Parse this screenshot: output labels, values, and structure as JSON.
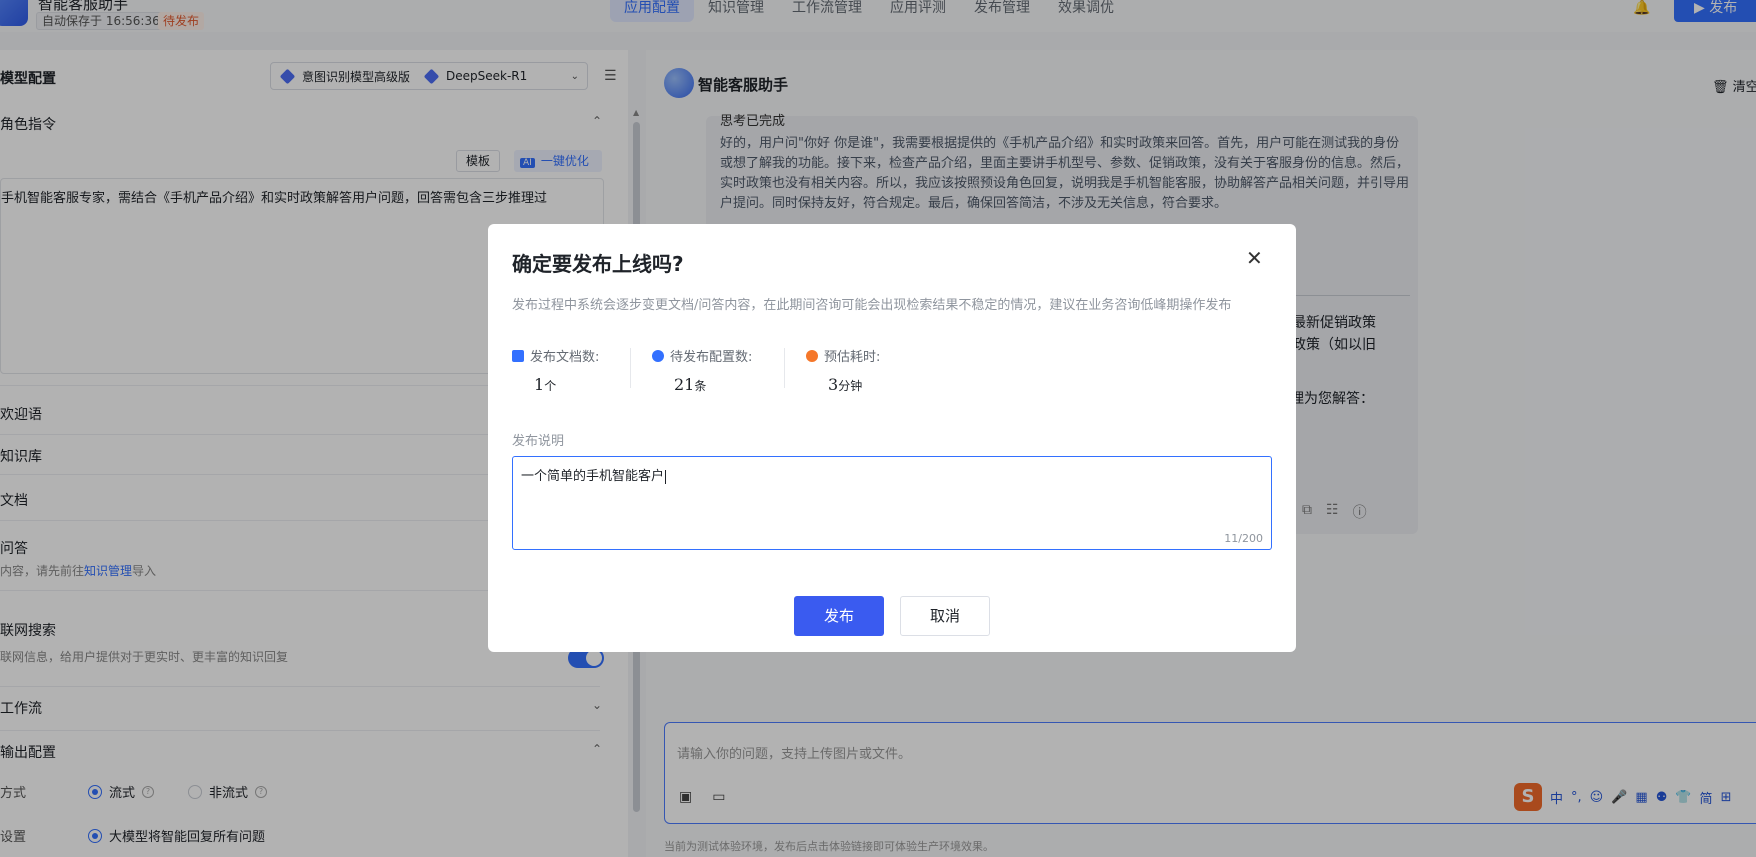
{
  "topbar": {
    "app_name": "智能客服助手",
    "autosave": "自动保存于 16:56:36",
    "status": "待发布",
    "nav": [
      "应用配置",
      "知识管理",
      "工作流管理",
      "应用评测",
      "发布管理",
      "效果调优"
    ],
    "active_nav": "应用配置",
    "publish_label": "发布",
    "bell_icon": "bell-icon"
  },
  "left": {
    "model_title": "模型配置",
    "model_intent": "意图识别模型高级版",
    "model_llm": "DeepSeek-R1",
    "role_section": "角色指令",
    "template_btn": "模板",
    "ai_badge": "AI",
    "optimize_btn": "一键优化",
    "prompt_text": "手机智能客服专家，需结合《手机产品介绍》和实时政策解答用户问题，回答需包含三步推理过",
    "welcome": "欢迎语",
    "kb": "知识库",
    "docs": "文档",
    "qa": "问答",
    "qa_hint_prefix": "内容，请先前往",
    "qa_hint_link": "知识管理",
    "qa_hint_suffix": "导入",
    "web_search": "联网搜索",
    "web_search_hint": "联网信息，给用户提供对于更实时、更丰富的知识回复",
    "workflow": "工作流",
    "output_config": "输出配置",
    "mode_label": "方式",
    "mode_stream": "流式",
    "mode_nonstream": "非流式",
    "answer_label": "设置",
    "answer_option": "大模型将智能回复所有问题"
  },
  "right": {
    "bot_title": "智能客服助手",
    "clear_label": "清空",
    "think_head": "思考已完成",
    "think_text": "好的，用户问\"你好 你是谁\"，我需要根据提供的《手机产品介绍》和实时政策来回答。首先，用户可能在测试我的身份或想了解我的功能。接下来，检查产品介绍，里面主要讲手机型号、参数、促销政策，没有关于客服身份的信息。然后，实时政策也没有相关内容。所以，我应该按照预设角色回复，说明我是手机智能客服，协助解答产品相关问题，并引导用户提问。同时保持友好，符合规定。最后，确保回答简洁，不涉及无关信息，符合要求。",
    "answer_line1": "及最新促销政策",
    "answer_line2": "售政策（如以旧",
    "answer_line3": "步推理为您解答：",
    "input_placeholder": "请输入你的问题，支持上传图片或文件。",
    "env_note": "当前为测试体验环境，发布后点击体验链接即可体验生产环境效果。",
    "ime": [
      "中",
      "°,",
      "☺",
      "🎤",
      "▦",
      "⚉",
      "👕",
      "简",
      "⊞"
    ]
  },
  "dialog": {
    "title": "确定要发布上线吗?",
    "description": "发布过程中系统会逐步变更文档/问答内容，在此期间咨询可能会出现检索结果不稳定的情况，建议在业务咨询低峰期操作发布",
    "stats": [
      {
        "label": "发布文档数:",
        "value": "1",
        "unit": "个",
        "icon": "document-icon"
      },
      {
        "label": "待发布配置数:",
        "value": "21",
        "unit": "条",
        "icon": "config-icon"
      },
      {
        "label": "预估耗时:",
        "value": "3",
        "unit": "分钟",
        "icon": "clock-icon"
      }
    ],
    "note_label": "发布说明",
    "note_value": "一个简单的手机智能客户",
    "counter": "11/200",
    "confirm": "发布",
    "cancel": "取消"
  }
}
